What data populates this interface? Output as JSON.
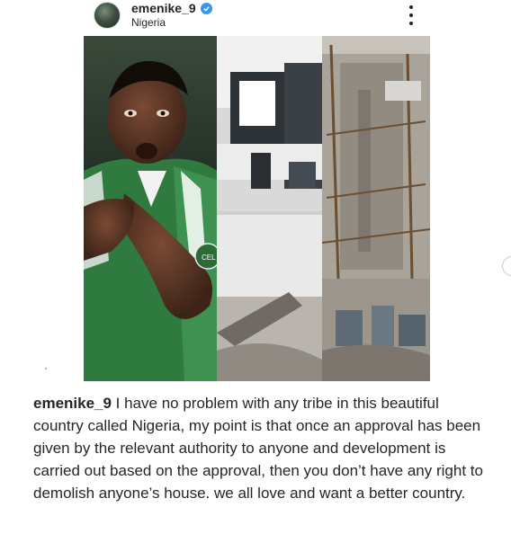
{
  "header": {
    "username": "emenike_9",
    "location": "Nigeria",
    "avatar_icon": "profile-avatar",
    "verified_icon": "verified-badge-icon",
    "more_icon": "more-vertical-icon",
    "verified_color": "#3897f0"
  },
  "post": {
    "photo_left": "player-celebrating-photo",
    "photo_middle": "modern-house-photo",
    "photo_right": "demolished-building-photo",
    "jersey_badge": "CEL"
  },
  "caption": {
    "username": "emenike_9",
    "text": " I have no problem with any tribe in this beautiful country called Nigeria, my point is that once an approval has been given by the relevant authority to anyone and development is carried out based on the approval, then you don’t have any right to demolish anyone’s house. we all love and want a better country."
  },
  "colors": {
    "text": "#262626",
    "background": "#ffffff",
    "jersey_green": "#2f7a3e"
  }
}
